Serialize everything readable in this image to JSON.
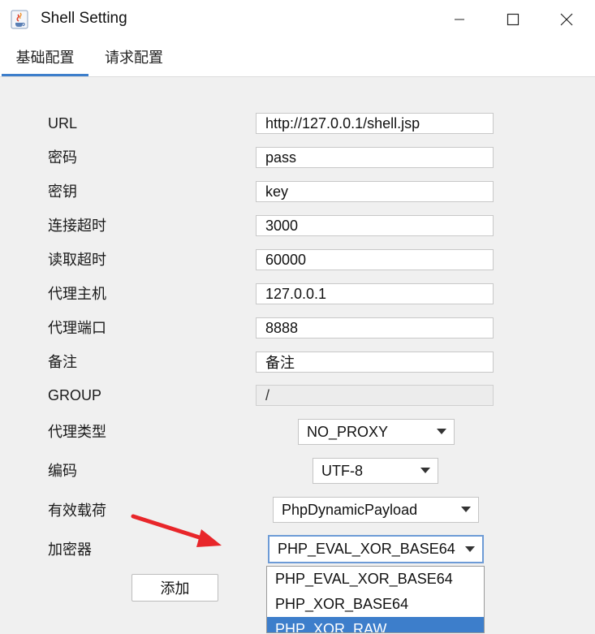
{
  "window": {
    "title": "Shell Setting",
    "icon": "java-cup-icon",
    "controls": [
      "minimize-icon",
      "maximize-icon",
      "close-icon"
    ]
  },
  "tabs": [
    {
      "label": "基础配置",
      "active": true
    },
    {
      "label": "请求配置",
      "active": false
    }
  ],
  "form": {
    "url": {
      "label": "URL",
      "value": "http://127.0.0.1/shell.jsp"
    },
    "password": {
      "label": "密码",
      "value": "pass"
    },
    "key": {
      "label": "密钥",
      "value": "key"
    },
    "connect_timeout": {
      "label": "连接超时",
      "value": "3000"
    },
    "read_timeout": {
      "label": "读取超时",
      "value": "60000"
    },
    "proxy_host": {
      "label": "代理主机",
      "value": "127.0.0.1"
    },
    "proxy_port": {
      "label": "代理端口",
      "value": "8888"
    },
    "remark": {
      "label": "备注",
      "value": "备注"
    },
    "group": {
      "label": "GROUP",
      "value": "/"
    },
    "proxy_type": {
      "label": "代理类型",
      "value": "NO_PROXY"
    },
    "encoding": {
      "label": "编码",
      "value": "UTF-8"
    },
    "payload": {
      "label": "有效载荷",
      "value": "PhpDynamicPayload"
    },
    "cryption": {
      "label": "加密器",
      "value": "PHP_EVAL_XOR_BASE64"
    }
  },
  "add_button": {
    "label": "添加"
  },
  "cryption_options": [
    {
      "label": "PHP_EVAL_XOR_BASE64",
      "highlighted": false
    },
    {
      "label": "PHP_XOR_BASE64",
      "highlighted": false
    },
    {
      "label": "PHP_XOR_RAW",
      "highlighted": true
    }
  ],
  "colors": {
    "accent": "#3d7ecb",
    "panel_bg": "#f0f0f0",
    "annotation_arrow": "#e8262a"
  }
}
